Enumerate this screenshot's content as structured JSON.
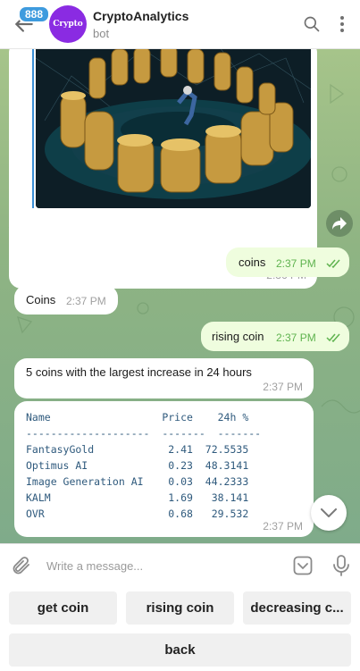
{
  "header": {
    "badge_count": "888",
    "avatar_text": "Crypto",
    "title": "CryptoAnalytics",
    "subtitle": "bot"
  },
  "messages": {
    "image_time": "2:36 PM",
    "coins_out": {
      "text": "coins",
      "time": "2:37 PM"
    },
    "coins_in": {
      "text": "Coins",
      "time": "2:37 PM"
    },
    "rising_out": {
      "text": "rising coin",
      "time": "2:37 PM"
    },
    "five_coins": {
      "text": "5 coins with the largest increase in 24 hours",
      "time": "2:37 PM"
    },
    "table": {
      "header": "Name                  Price    24h %",
      "divider": "--------------------  -------  -------",
      "rows": [
        "FantasyGold            2.41  72.5535",
        "Optimus AI             0.23  48.3141",
        "Image Generation AI    0.03  44.2333",
        "KALM                   1.69   38.141",
        "OVR                    0.68   29.532"
      ],
      "time": "2:37 PM"
    }
  },
  "input": {
    "placeholder": "Write a message..."
  },
  "keyboard": {
    "buttons": [
      "get coin",
      "rising coin",
      "decreasing c...",
      "back"
    ]
  },
  "colors": {
    "accent": "#3e9bde",
    "avatar": "#8a2be2",
    "out_bubble": "#effdde",
    "out_time": "#5fb34f"
  }
}
